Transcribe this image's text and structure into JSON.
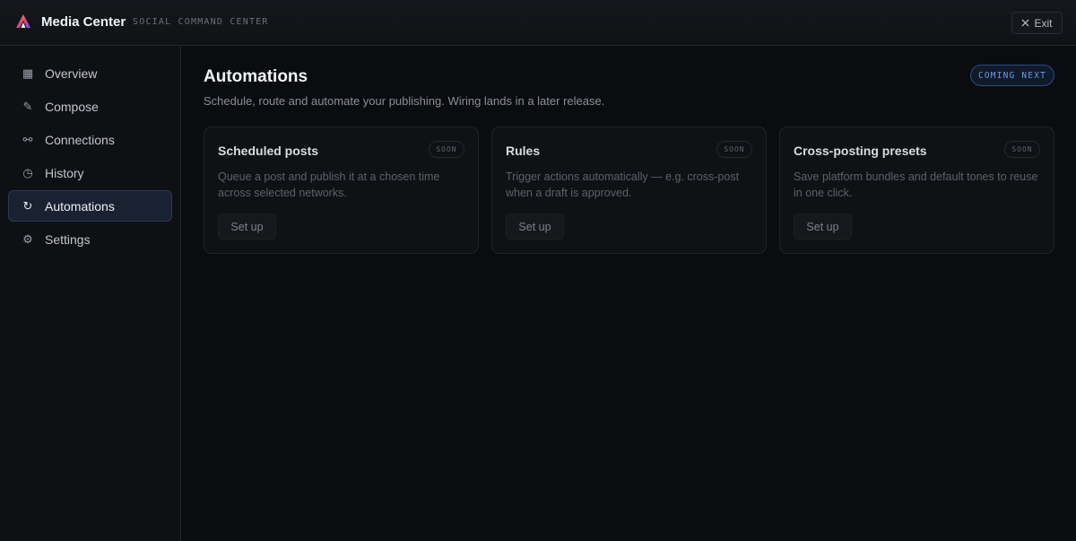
{
  "app": {
    "title": "Media Center",
    "subtitle": "SOCIAL COMMAND CENTER",
    "logo_icon": "triangle-logo",
    "exit_label": "Exit",
    "exit_icon": "close-icon"
  },
  "sidebar": {
    "items": [
      {
        "label": "Overview",
        "icon": "grid-icon",
        "glyph": "▦",
        "active": false
      },
      {
        "label": "Compose",
        "icon": "pen-icon",
        "glyph": "✎",
        "active": false
      },
      {
        "label": "Connections",
        "icon": "link-icon",
        "glyph": "⚯",
        "active": false
      },
      {
        "label": "History",
        "icon": "clock-icon",
        "glyph": "◷",
        "active": false
      },
      {
        "label": "Automations",
        "icon": "refresh-icon",
        "glyph": "↻",
        "active": true
      },
      {
        "label": "Settings",
        "icon": "gear-icon",
        "glyph": "⚙",
        "active": false
      }
    ]
  },
  "main": {
    "title": "Automations",
    "description": "Schedule, route and automate your publishing. Wiring lands in a later release.",
    "badge": "COMING NEXT",
    "cards": [
      {
        "title": "Scheduled posts",
        "badge": "SOON",
        "description": "Queue a post and publish it at a chosen time across selected networks.",
        "button": "Set up"
      },
      {
        "title": "Rules",
        "badge": "SOON",
        "description": "Trigger actions automatically — e.g. cross-post when a draft is approved.",
        "button": "Set up"
      },
      {
        "title": "Cross-posting presets",
        "badge": "SOON",
        "description": "Save platform bundles and default tones to reuse in one click.",
        "button": "Set up"
      }
    ]
  },
  "colors": {
    "background": "#0b0c0f",
    "accent": "#6f9ae0",
    "active_nav": "#1a2130"
  }
}
